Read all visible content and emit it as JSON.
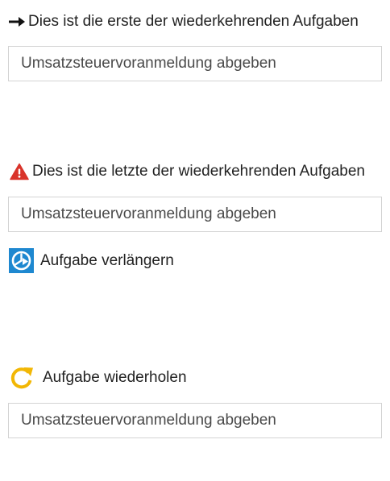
{
  "sections": [
    {
      "icon": "arrow-right-icon",
      "label": "Dies ist die erste der wiederkehrenden Aufgaben",
      "field_value": "Umsatzsteuervoranmeldung abgeben"
    },
    {
      "icon": "warning-triangle-icon",
      "label": "Dies ist die letzte der wiederkehrenden Aufgaben",
      "field_value": "Umsatzsteuervoranmeldung abgeben"
    },
    {
      "icon": "clock-extend-icon",
      "label": "Aufgabe verlängern"
    },
    {
      "icon": "refresh-icon",
      "label": "Aufgabe wiederholen",
      "field_value": "Umsatzsteuervoranmeldung abgeben"
    }
  ],
  "colors": {
    "warning": "#d9342b",
    "extend_icon_bg": "#1e88d0",
    "repeat_icon": "#f2b705",
    "field_border": "#d3d3d3",
    "text": "#222222"
  }
}
